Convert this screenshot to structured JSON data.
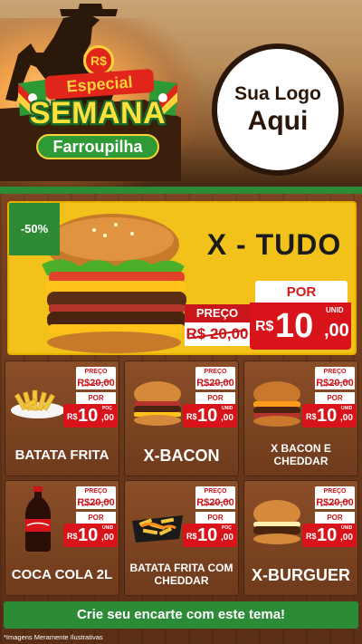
{
  "header": {
    "badge_currency": "R$",
    "badge_line1": "Especial",
    "badge_line2": "SEMANA",
    "badge_line3": "Farroupilha",
    "logo_line1": "Sua Logo",
    "logo_line2": "Aqui"
  },
  "featured": {
    "discount": "-50%",
    "name": "X - TUDO",
    "preco_label": "PREÇO",
    "old_price": "R$ 20,00",
    "por_label": "POR",
    "currency": "R$",
    "price_int": "10",
    "price_cents": ",00",
    "unit": "UNID"
  },
  "products": [
    {
      "name": "BATATA FRITA",
      "preco_label": "PREÇO",
      "old_price": "R$20,00",
      "por_label": "POR",
      "currency": "R$",
      "price_int": "10",
      "price_cents": ",00",
      "unit": "POÇ",
      "icon": "fries-icon"
    },
    {
      "name": "X-BACON",
      "preco_label": "PREÇO",
      "old_price": "R$20,00",
      "por_label": "POR",
      "currency": "R$",
      "price_int": "10",
      "price_cents": ",00",
      "unit": "UNID",
      "icon": "bacon-burger-icon"
    },
    {
      "name": "X BACON E CHEDDAR",
      "preco_label": "PREÇO",
      "old_price": "R$20,00",
      "por_label": "POR",
      "currency": "R$",
      "price_int": "10",
      "price_cents": ",00",
      "unit": "UNID",
      "icon": "cheddar-burger-icon"
    },
    {
      "name": "COCA COLA 2L",
      "preco_label": "PREÇO",
      "old_price": "R$20,00",
      "por_label": "POR",
      "currency": "R$",
      "price_int": "10",
      "price_cents": ",00",
      "unit": "UNID",
      "icon": "soda-bottle-icon"
    },
    {
      "name": "BATATA FRITA COM CHEDDAR",
      "preco_label": "PREÇO",
      "old_price": "R$20,00",
      "por_label": "POR",
      "currency": "R$",
      "price_int": "10",
      "price_cents": ",00",
      "unit": "POÇ",
      "icon": "cheddar-fries-icon"
    },
    {
      "name": "X-BURGUER",
      "preco_label": "PREÇO",
      "old_price": "R$20,00",
      "por_label": "POR",
      "currency": "R$",
      "price_int": "10",
      "price_cents": ",00",
      "unit": "UNID",
      "icon": "burger-icon"
    }
  ],
  "footer": {
    "cta": "Crie seu encarte com este tema!",
    "disclaimer": "*Imagens Meramente Ilustrativas"
  },
  "colors": {
    "brand_green": "#2c8b36",
    "price_red": "#d8141a",
    "featured_yellow": "#f2c21a",
    "wood_brown": "#6a391b"
  }
}
